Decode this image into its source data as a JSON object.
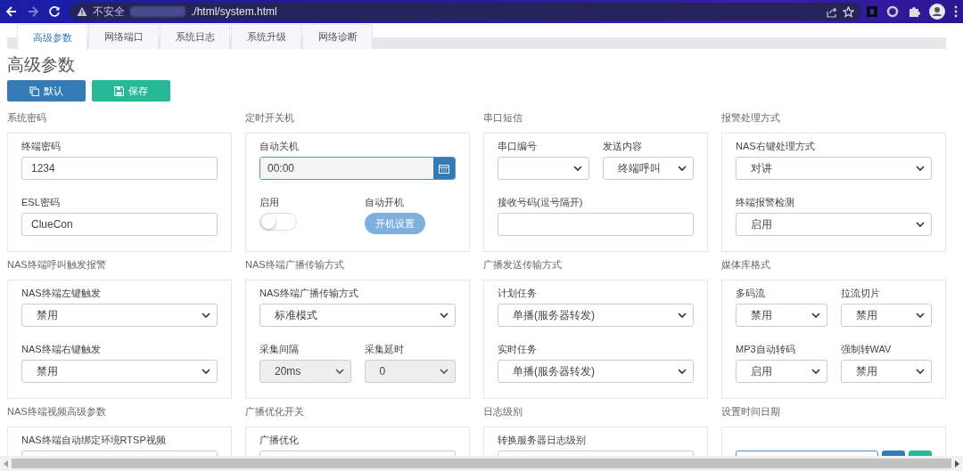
{
  "browser": {
    "security": "不安全",
    "url": "./html/system.html"
  },
  "tabs": [
    {
      "label": "高级参数",
      "selected": true
    },
    {
      "label": "网络端口",
      "selected": false
    },
    {
      "label": "系统日志",
      "selected": false
    },
    {
      "label": "系统升级",
      "selected": false
    },
    {
      "label": "网络诊断",
      "selected": false
    }
  ],
  "page_title": "高级参数",
  "actions": [
    {
      "kind": "default",
      "label": "默认"
    },
    {
      "kind": "save",
      "label": "保存"
    }
  ],
  "sections": [
    {
      "heading": "系统密码",
      "rows": [
        [
          {
            "kind": "text",
            "label": "终端密码",
            "value": "1234"
          }
        ],
        [
          {
            "kind": "text",
            "label": "ESL密码",
            "value": "ClueCon"
          }
        ]
      ]
    },
    {
      "heading": "定时开关机",
      "rows": [
        [
          {
            "kind": "time",
            "label": "自动关机",
            "value": "00:00"
          }
        ],
        [
          {
            "kind": "toggle",
            "label": "启用",
            "on": false
          },
          {
            "kind": "button",
            "label": "自动开机",
            "button": "开机设置"
          }
        ]
      ]
    },
    {
      "heading": "串口短信",
      "rows": [
        [
          {
            "kind": "select",
            "label": "串口编号",
            "disabled": false
          },
          {
            "kind": "select",
            "label": "发送内容",
            "value": "终端呼叫",
            "disabled": false
          }
        ],
        [
          {
            "kind": "text",
            "label": "接收号码(逗号隔开)"
          }
        ]
      ]
    },
    {
      "heading": "报警处理方式",
      "rows": [
        [
          {
            "kind": "select",
            "label": "NAS右键处理方式",
            "value": "对讲",
            "disabled": false
          }
        ],
        [
          {
            "kind": "select",
            "label": "终端报警检测",
            "value": "启用",
            "disabled": false
          }
        ]
      ]
    },
    {
      "heading": "NAS终端呼叫触发报警",
      "rows": [
        [
          {
            "kind": "select",
            "label": "NAS终端左键触发",
            "value": "禁用",
            "disabled": false
          }
        ],
        [
          {
            "kind": "select",
            "label": "NAS终端右键触发",
            "value": "禁用",
            "disabled": false
          }
        ]
      ]
    },
    {
      "heading": "NAS终端广播传输方式",
      "rows": [
        [
          {
            "kind": "select",
            "label": "NAS终端广播传输方式",
            "value": "标准模式",
            "disabled": false
          }
        ],
        [
          {
            "kind": "select",
            "label": "采集间隔",
            "value": "20ms",
            "disabled": true
          },
          {
            "kind": "select",
            "label": "采集延时",
            "value": "0",
            "disabled": true
          }
        ]
      ]
    },
    {
      "heading": "广播发送传输方式",
      "rows": [
        [
          {
            "kind": "select",
            "label": "计划任务",
            "value": "单播(服务器转发)",
            "disabled": false
          }
        ],
        [
          {
            "kind": "select",
            "label": "实时任务",
            "value": "单播(服务器转发)",
            "disabled": false
          }
        ]
      ]
    },
    {
      "heading": "媒体库格式",
      "rows": [
        [
          {
            "kind": "select",
            "label": "多码流",
            "value": "禁用",
            "disabled": false
          },
          {
            "kind": "select",
            "label": "拉流切片",
            "value": "禁用",
            "disabled": false
          }
        ],
        [
          {
            "kind": "select",
            "label": "MP3自动转码",
            "value": "启用",
            "disabled": false
          },
          {
            "kind": "select",
            "label": "强制转WAV",
            "value": "禁用",
            "disabled": false
          }
        ]
      ]
    },
    {
      "heading": "NAS终端视频高级参数",
      "rows": [
        [
          {
            "kind": "select",
            "label": "NAS终端自动绑定环境RTSP视频",
            "disabled": false
          }
        ]
      ]
    },
    {
      "heading": "广播优化开关",
      "rows": [
        [
          {
            "kind": "select",
            "label": "广播优化",
            "disabled": false
          }
        ]
      ]
    },
    {
      "heading": "日志级别",
      "rows": [
        [
          {
            "kind": "select",
            "label": "转换服务器日志级别",
            "disabled": false
          }
        ]
      ]
    },
    {
      "heading": "设置时间日期",
      "rows": [
        [
          {
            "kind": "datetime"
          }
        ]
      ]
    }
  ]
}
